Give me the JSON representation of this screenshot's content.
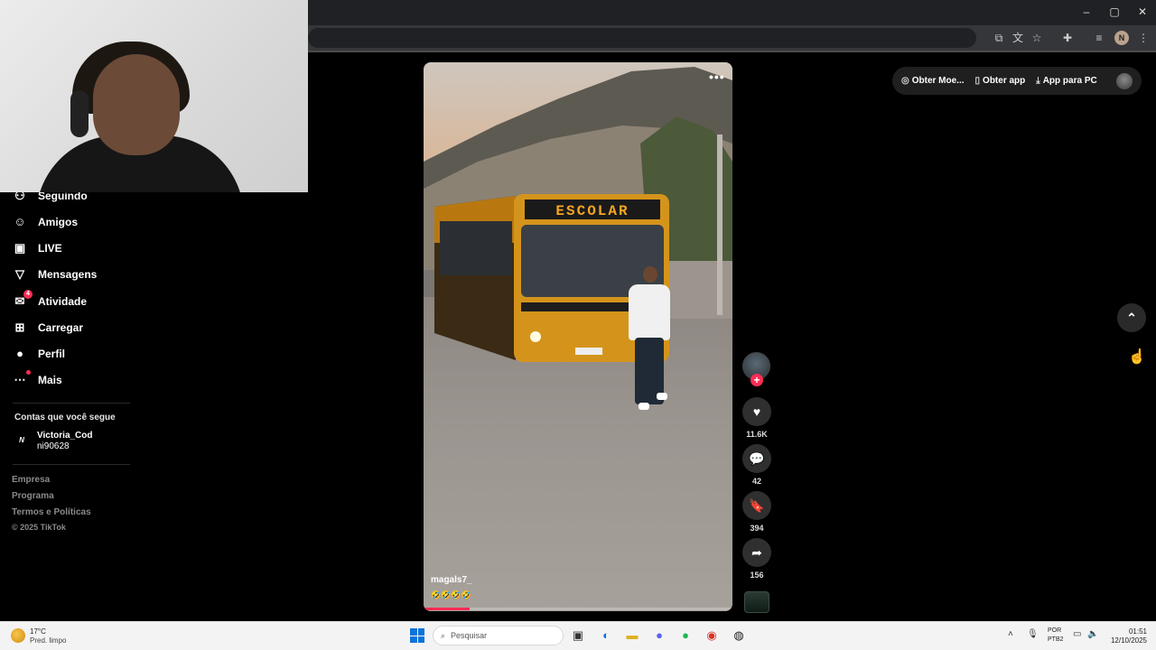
{
  "browser": {
    "window_controls": {
      "minimize": "–",
      "maximize": "▢",
      "close": "✕"
    },
    "toolbar_icons": [
      "install-icon",
      "translate-icon",
      "star-icon",
      "extensions-icon",
      "media-icon"
    ],
    "profile_initial": "N"
  },
  "sidebar": {
    "items": [
      {
        "label": "Seguindo",
        "icon": "following-icon",
        "glyph": "⚇"
      },
      {
        "label": "Amigos",
        "icon": "friends-icon",
        "glyph": "☺"
      },
      {
        "label": "LIVE",
        "icon": "live-icon",
        "glyph": "▣"
      },
      {
        "label": "Mensagens",
        "icon": "messages-icon",
        "glyph": "▽"
      },
      {
        "label": "Atividade",
        "icon": "activity-icon",
        "glyph": "✉",
        "badge": "4"
      },
      {
        "label": "Carregar",
        "icon": "upload-icon",
        "glyph": "⊞"
      },
      {
        "label": "Perfil",
        "icon": "profile-icon",
        "glyph": "●"
      },
      {
        "label": "Mais",
        "icon": "more-icon",
        "glyph": "⋯"
      }
    ],
    "following_title": "Contas que você segue",
    "following": [
      {
        "name": "Victoria_Cod",
        "sub": "ni90628",
        "avatar_letter": "N"
      }
    ],
    "footer_links": [
      "Empresa",
      "Programa",
      "Termos e Políticas"
    ],
    "copyright": "© 2025 TikTok"
  },
  "video": {
    "author": "magals7_",
    "caption": "🤣🤣🤣🤣",
    "bus_sign": "ESCOLAR",
    "more_label": "•••",
    "progress": 0.15
  },
  "actions": {
    "likes": "11.6K",
    "comments": "42",
    "saves": "394",
    "shares": "156",
    "follow_plus": "+",
    "like_glyph": "♥",
    "comment_glyph": "💬",
    "save_glyph": "🔖",
    "share_glyph": "➦"
  },
  "top_bar": {
    "coins": "Obter Moe...",
    "get_app": "Obter app",
    "pc_app": "App para PC"
  },
  "nav_up": "⌃",
  "taskbar": {
    "temp": "17°C",
    "weather": "Pred. limpo",
    "search_placeholder": "Pesquisar",
    "lang_line1": "POR",
    "lang_line2": "PTB2",
    "time": "01:51",
    "date": "12/10/2025"
  },
  "colors": {
    "accent": "#fe2c55",
    "windows_blue": "#0a74da"
  }
}
